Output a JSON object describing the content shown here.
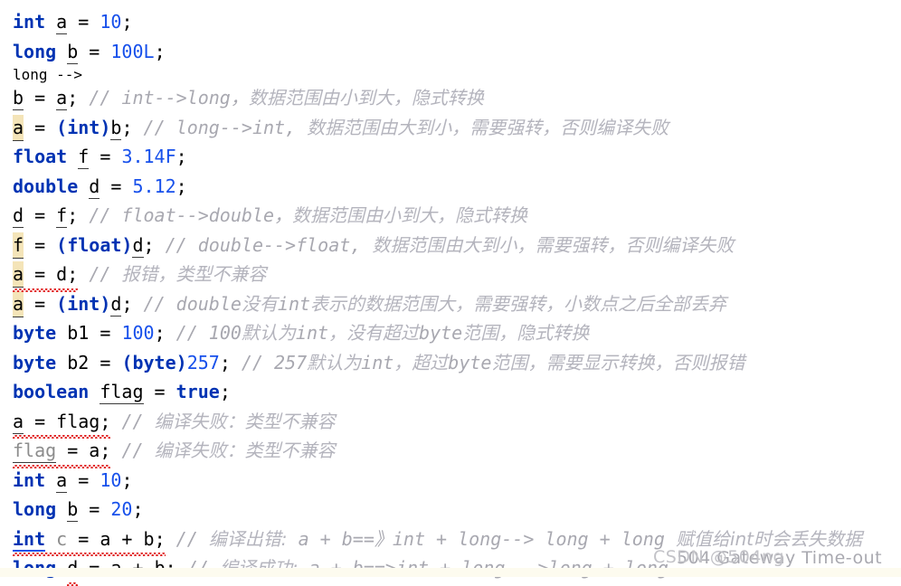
{
  "editor": {
    "language": "Java",
    "background_color": "#ffffff",
    "keyword_color": "#0033b3",
    "number_color": "#1750eb",
    "comment_color": "#a8a8b0",
    "error_underline_color": "#e01b1b",
    "highlight_color": "#f4e4b8"
  },
  "watermarks": {
    "csdn": "CSDN @504ng",
    "gateway": "504 Gateway Time-out"
  },
  "code": {
    "lines": [
      {
        "id": "line-1",
        "text": "int a = 10;",
        "tokens": [
          {
            "t": "int",
            "c": "kw"
          },
          {
            "t": " ",
            "c": "punc"
          },
          {
            "t": "a",
            "c": "ident u-dot"
          },
          {
            "t": " = ",
            "c": "op"
          },
          {
            "t": "10",
            "c": "num"
          },
          {
            "t": ";",
            "c": "punc"
          }
        ]
      },
      {
        "id": "line-2",
        "text": "long b = 100L;",
        "tokens": [
          {
            "t": "long",
            "c": "kw"
          },
          {
            "t": " ",
            "c": "punc"
          },
          {
            "t": "b",
            "c": "ident u-dot"
          },
          {
            "t": " = ",
            "c": "op"
          },
          {
            "t": "100L",
            "c": "num"
          },
          {
            "t": ";",
            "c": "punc"
          }
        ]
      },
      {
        "id": "line-3",
        "text": "b = a; // int-->long，数据范围由小到大，隐式转换",
        "comment_en": "// int-->long，",
        "comment_cn": "数据范围由小到大，隐式转换"
      },
      {
        "id": "line-4",
        "text": "a = (int)b; // long-->int， 数据范围由大到小，需要强转，否则编译失败",
        "comment_en": "// long-->int, ",
        "comment_cn": "数据范围由大到小，需要强转，否则编译失败"
      },
      {
        "id": "line-5",
        "text": "float f = 3.14F;",
        "tokens": [
          {
            "t": "float",
            "c": "kw"
          },
          {
            "t": " ",
            "c": "punc"
          },
          {
            "t": "f",
            "c": "ident u-dot"
          },
          {
            "t": " = ",
            "c": "op"
          },
          {
            "t": "3.14F",
            "c": "num"
          },
          {
            "t": ";",
            "c": "punc"
          }
        ]
      },
      {
        "id": "line-6",
        "text": "double d = 5.12;",
        "tokens": [
          {
            "t": "double",
            "c": "kw"
          },
          {
            "t": " ",
            "c": "punc"
          },
          {
            "t": "d",
            "c": "ident u-dot"
          },
          {
            "t": " = ",
            "c": "op"
          },
          {
            "t": "5.12",
            "c": "num"
          },
          {
            "t": ";",
            "c": "punc"
          }
        ]
      },
      {
        "id": "line-7",
        "text": "d = f; // float-->double，数据范围由小到大，隐式转换",
        "comment_en": "// float-->double，",
        "comment_cn": "数据范围由小到大，隐式转换"
      },
      {
        "id": "line-8",
        "text": "f = (float)d; // double-->float, 数据范围由大到小，需要强转，否则编译失败",
        "comment_en": "// double-->float, ",
        "comment_cn": "数据范围由大到小，需要强转，否则编译失败"
      },
      {
        "id": "line-9",
        "text": "a = d; // 报错，类型不兼容",
        "comment_en": "// ",
        "comment_cn": "报错，类型不兼容"
      },
      {
        "id": "line-10",
        "text": "a = (int)d; // double没有int表示的数据范围大，需要强转，小数点之后全部丢弃",
        "comment_cn_1": "double",
        "comment_cn_2": "没有",
        "comment_cn_3": "int",
        "comment_cn_4": "表示的数据范围大，需要强转，小数点之后全部丢弃"
      },
      {
        "id": "line-11",
        "text": "byte b1 = 100; // 100默认为int，没有超过byte范围，隐式转换"
      },
      {
        "id": "line-12",
        "text": "byte b2 = (byte)257; // 257默认为int，超过byte范围，需要显示转换，否则报错"
      },
      {
        "id": "line-13",
        "text": "boolean flag = true;",
        "tokens": [
          {
            "t": "boolean",
            "c": "kw"
          },
          {
            "t": " ",
            "c": "punc"
          },
          {
            "t": "flag",
            "c": "ident u-dot"
          },
          {
            "t": " = ",
            "c": "op"
          },
          {
            "t": "true",
            "c": "kw"
          },
          {
            "t": ";",
            "c": "punc"
          }
        ]
      },
      {
        "id": "line-14",
        "text": "a = flag; // 编译失败：类型不兼容",
        "comment_cn": "编译失败：类型不兼容"
      },
      {
        "id": "line-15",
        "text": "flag = a; // 编译失败：类型不兼容",
        "comment_cn": "编译失败：类型不兼容"
      },
      {
        "id": "line-16",
        "text": "int a = 10;"
      },
      {
        "id": "line-17",
        "text": "long b = 20;"
      },
      {
        "id": "line-18",
        "text": "int c = a + b; // 编译出错: a + b==》int + long--> long + long 赋值给int时会丢失数据",
        "comment_cn": "编译出错:",
        "comment_expr": "a + b==》int + long--> long + long",
        "comment_tail": "赋值给int时会丢失数据"
      },
      {
        "id": "line-19",
        "text": "long d = a + b; // 编译成功: a + b==>int + long--->long + long",
        "comment_cn": "编译成功:",
        "comment_expr": "a + b==>int + long--->long + long"
      }
    ]
  },
  "symbols": {
    "int": "int",
    "long": "long",
    "float": "float",
    "double": "double",
    "byte": "byte",
    "boolean": "boolean",
    "true": "true",
    "a": "a",
    "b": "b",
    "c": "c",
    "d": "d",
    "f": "f",
    "b1": "b1",
    "b2": "b2",
    "flag": "flag",
    "v10": "10",
    "v20": "20",
    "v100L": "100L",
    "v100": "100",
    "v257": "257",
    "v314F": "3.14F",
    "v512": "5.12",
    "slash": "//",
    "semi": ";",
    "eq": " = ",
    "plus": " + ",
    "castInt": "(int)",
    "castFloat": "(float)",
    "castByte": "(byte)"
  },
  "comment_text": {
    "l3_en": "// int-->long，",
    "l3_cn": "数据范围由小到大，隐式转换",
    "l4_en": "// long-->int, ",
    "l4_cn": "数据范围由大到小，需要强转，否则编译失败",
    "l7_en": "// float-->double，",
    "l7_cn": "数据范围由小到大，隐式转换",
    "l8_en": "// double-->float, ",
    "l8_cn": "数据范围由大到小，需要强转，否则编译失败",
    "l9_slash": "// ",
    "l9_cn": "报错，类型不兼容",
    "l10_slash": "// ",
    "l10_a": "double",
    "l10_b": "没有",
    "l10_c": "int",
    "l10_d": "表示的数据范围大，需要强转，小数点之后全部丢弃",
    "l11_slash": "// ",
    "l11_a": "100",
    "l11_b": "默认为",
    "l11_c": "int",
    "l11_d": "，没有超过",
    "l11_e": "byte",
    "l11_f": "范围，隐式转换",
    "l12_slash": "// ",
    "l12_a": "257",
    "l12_b": "默认为",
    "l12_c": "int",
    "l12_d": "，超过",
    "l12_e": "byte",
    "l12_f": "范围，需要显示转换，否则报错",
    "l14_slash": "// ",
    "l14_cn": "编译失败：类型不兼容",
    "l15_slash": "// ",
    "l15_cn": "编译失败：类型不兼容",
    "l18_slash": "// ",
    "l18_cn": "编译出错:",
    "l18_expr": " a + b==》int + long--> long + long ",
    "l18_tail": "赋值给int时会丢失数据",
    "l19_slash": "// ",
    "l19_cn": "编译成功:",
    "l19_expr": " a + b==>int + long--->long + long"
  }
}
